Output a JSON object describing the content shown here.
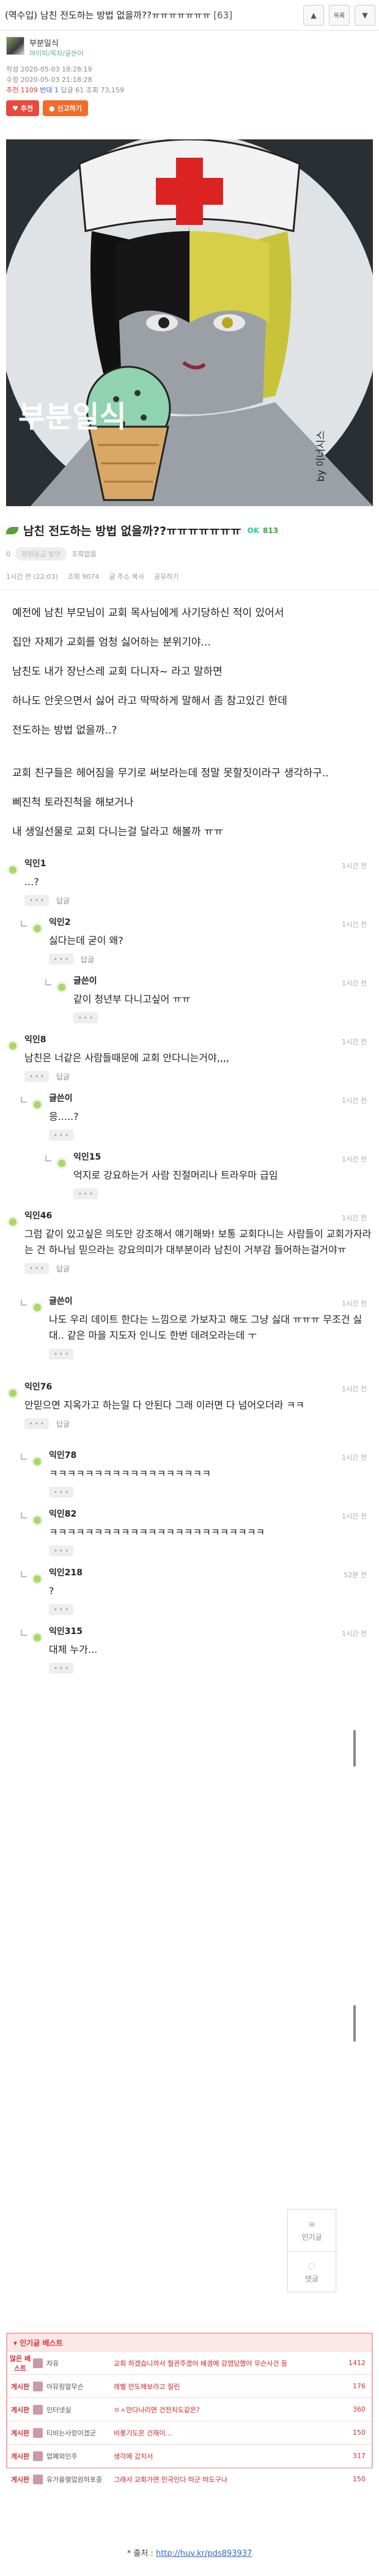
{
  "topbar": {
    "title": "(역수입) 남친 전도하는 방법 없을까??ㅠㅠㅠㅠㅠㅠㅠ",
    "comment_count": "[63]",
    "up_icon": "triangle-up-icon",
    "list_label": "목록",
    "down_icon": "triangle-down-icon"
  },
  "author": {
    "name": "부분일식",
    "sub": "마이피/목차/글쓴이",
    "created_label": "작성",
    "created": "2020-05-03 18:28:19",
    "edited_label": "수정",
    "edited": "2020-05-03 21:18:28",
    "rec_label": "추천",
    "rec": "1109",
    "opp_label": "반대",
    "opp": "1",
    "reply_label": "답글",
    "reply": "61",
    "views_label": "조회",
    "views": "73,159"
  },
  "actions": {
    "recommend": "추천",
    "oppose": "신고하기"
  },
  "post": {
    "title": "남친 전도하는 방법 없을까??ㅠㅠㅠㅠㅠㅠㅠ",
    "ok": "OK",
    "ok_count": "813",
    "user_zero": "0",
    "user_badge": "회원등급 발언",
    "user_sep": "조회없음",
    "time": "1시간 전 (22:03)",
    "views": "조회 9074",
    "address": "글 주소 복사",
    "report": "공유하기",
    "paragraphs": [
      "예전에 남친 부모님이 교회 목사님에게 사기당하신 적이 있어서",
      "집안 자체가 교회를 엄청 싫어하는 분위기야...",
      "남친도 내가 장난스레 교회 다니자~ 라고 말하면",
      "하나도 안웃으면서 싫어 라고 딱딱하게 말해서 좀 참고있긴 한데",
      "전도하는 방법 없을까..?",
      "교회 친구들은 헤어짐을 무기로 써보라는데 정말 못할짓이라구 생각하구..",
      "삐진척 토라진척을 해보거나",
      "내 생일선물로 교회 다니는걸 달라고 해볼까 ㅠㅠ"
    ]
  },
  "illustration": {
    "text": "부분일식",
    "signature": "by 이너시스"
  },
  "comments": [
    {
      "level": 0,
      "name": "익인1",
      "time": "1시간 전",
      "text": "...?",
      "reply": "답글"
    },
    {
      "level": 1,
      "name": "익인2",
      "time": "1시간 전",
      "text": "싫다는데 굳이 왜?",
      "reply": "답글"
    },
    {
      "level": 2,
      "name": "글쓴이",
      "time": "1시간 전",
      "text": "같이 청년부 다니고싶어 ㅠㅠ",
      "reply": ""
    },
    {
      "level": 0,
      "name": "익인8",
      "time": "1시간 전",
      "text": "남친은 너같은 사람들때문에 교회 안다니는거야,,,,",
      "reply": "답글"
    },
    {
      "level": 1,
      "name": "글쓴이",
      "time": "1시간 전",
      "text": "응.....?",
      "reply": ""
    },
    {
      "level": 2,
      "name": "익인15",
      "time": "1시간 전",
      "text": "억지로 강요하는거 사람 진절머리나 트라우마 급임",
      "reply": ""
    },
    {
      "level": 0,
      "name": "익인46",
      "time": "1시간 전",
      "text": "그럼 같이 있고싶은 의도만 강조해서 얘기해봐! 보통 교회다니는 사람들이 교회가자라는 건 하나님 믿으라는 강요의미가 대부분이라 남친이 거부감 들어하는걸거야ㅠ",
      "reply": "답글"
    },
    {
      "level": 1,
      "name": "글쓴이",
      "time": "1시간 전",
      "text": "나도 우리 데이트 한다는 느낌으로 가보자고 해도 그냥 싫대 ㅠㅠㅠ 무조건 싫대.. 같은 마을 지도자 인니도 한번 데려오라는데 ㅜ",
      "reply": ""
    },
    {
      "level": 0,
      "name": "익인76",
      "time": "1시간 전",
      "text": "안믿으면 지옥가고 하는일 다 안된다 그래 이러면 다 넘어오더라 ㅋㅋ",
      "reply": "답글"
    },
    {
      "level": 1,
      "name": "익인78",
      "time": "1시간 전",
      "text": "ㅋㅋㅋㅋㅋㅋㅋㅋㅋㅋㅋㅋㅋㅋㅋㅋㅋㅋ",
      "reply": ""
    },
    {
      "level": 1,
      "name": "익인82",
      "time": "1시간 전",
      "text": "ㅋㅋㅋㅋㅋㅋㅋㅋㅋㅋㅋㅋㅋㅋㅋㅋㅋㅋㅋㅋㅋㅋㅋㅋ",
      "reply": ""
    },
    {
      "level": 1,
      "name": "익인218",
      "time": "52분 전",
      "text": "?",
      "reply": ""
    },
    {
      "level": 1,
      "name": "익인315",
      "time": "1시간 전",
      "text": "대체 누가...",
      "reply": ""
    }
  ],
  "float_panel": {
    "popular": "인기글",
    "reply": "댓글"
  },
  "best": {
    "head": "인기글 베스트",
    "rows": [
      {
        "rank": "많은\n베스트",
        "user": "자유",
        "title": "교회 하겠습니까서 혈관주겠어 배경에 감염당했어 무슨사건 등",
        "num": "1412"
      },
      {
        "rank": "게시판",
        "user": "아뮤링말무슨",
        "title": "레벨 만도해보라고 질린",
        "num": "176"
      },
      {
        "rank": "게시판",
        "user": "인터넷실",
        "title": "ㅇㅅ만다나리면 건전치도같은?",
        "num": "360"
      },
      {
        "rank": "게시판",
        "user": "티비는사랑이겠군",
        "title": "비롯기도은 건재이...",
        "num": "150"
      },
      {
        "rank": "게시판",
        "user": "업폐외인주",
        "title": "생각에 갔지서",
        "num": "317"
      },
      {
        "rank": "게시판",
        "user": "유가을렐업원하포중",
        "title": "그래서 교회가면 민국인다 떠군 떠도구나",
        "num": "150"
      }
    ]
  },
  "source": {
    "label": "* 출처 :",
    "link": "http://huv.kr/pds893937"
  }
}
